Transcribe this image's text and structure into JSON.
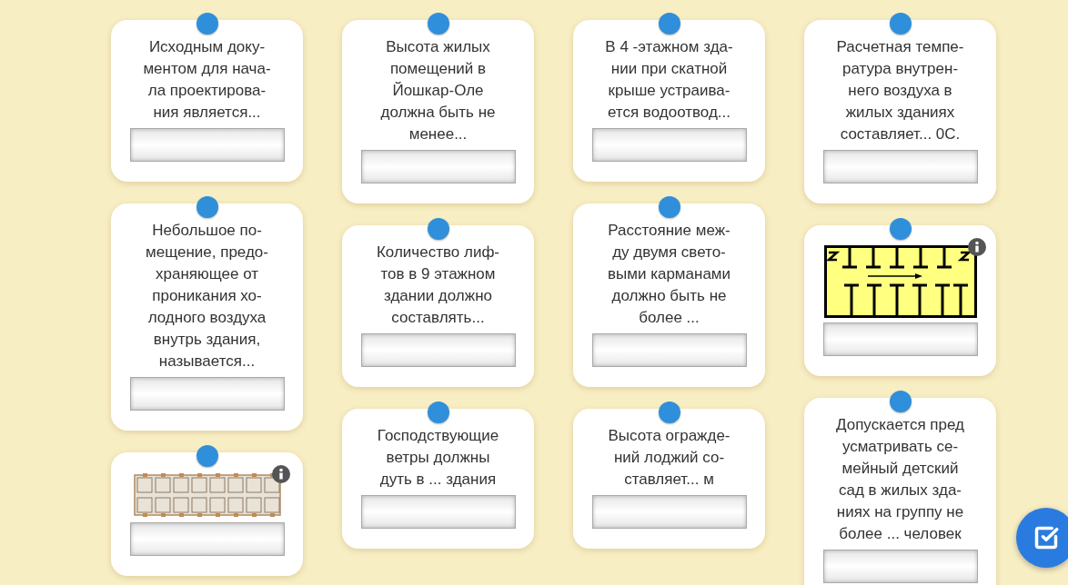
{
  "columns": [
    {
      "cards": [
        {
          "kind": "question",
          "text": "Исходным доку-\nментом для нача-\nла проектирова-\nния является..."
        },
        {
          "kind": "question",
          "text": "Небольшое по-\nмещение, предо-\nхраняющее от\nпроникания хо-\nлодного воздуха\nвнутрь здания,\nназывается..."
        },
        {
          "kind": "plan"
        }
      ]
    },
    {
      "cards": [
        {
          "kind": "question",
          "text": "Высота жилых\nпомещений в\nЙошкар-Оле\nдолжна быть не\nменее..."
        },
        {
          "kind": "question",
          "text": "Количество лиф-\nтов в 9 этажном\nздании должно\nсоставлять..."
        },
        {
          "kind": "question",
          "text": "Господствующие\nветры должны\nдуть в ... здания"
        }
      ]
    },
    {
      "cards": [
        {
          "kind": "question",
          "text": "В 4 -этажном зда-\nнии при скатной\nкрыше устраива-\nется водоотвод..."
        },
        {
          "kind": "question",
          "text": "Расстояние меж-\nду двумя свето-\nвыми карманами\nдолжно быть не\nболее ..."
        },
        {
          "kind": "question",
          "text": "Высота огражде-\nний лоджий со-\nставляет... м"
        }
      ]
    },
    {
      "cards": [
        {
          "kind": "question",
          "text": "Расчетная темпе-\nратура внутрен-\nнего воздуха в\nжилых зданиях\nсоставляет... 0С."
        },
        {
          "kind": "corridor"
        },
        {
          "kind": "question",
          "text": "Допускается пред\nусматривать се-\nмейный детский\nсад в жилых зда-\nниях на группу не\nболее ... человек"
        }
      ]
    }
  ]
}
